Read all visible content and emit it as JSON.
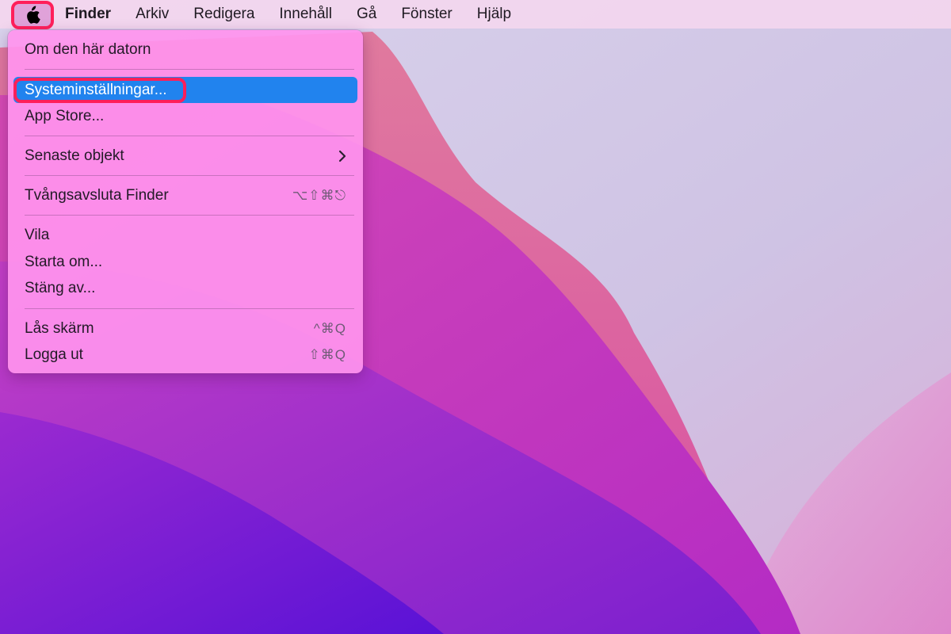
{
  "menubar": {
    "apple_icon": "apple-logo-icon",
    "items": [
      {
        "label": "Finder",
        "bold": true
      },
      {
        "label": "Arkiv"
      },
      {
        "label": "Redigera"
      },
      {
        "label": "Innehåll"
      },
      {
        "label": "Gå"
      },
      {
        "label": "Fönster"
      },
      {
        "label": "Hjälp"
      }
    ]
  },
  "apple_menu": {
    "items": [
      {
        "label": "Om den här datorn"
      },
      {
        "label": "Systeminställningar..."
      },
      {
        "label": "App Store..."
      },
      {
        "label": "Senaste objekt",
        "submenu_icon": "chevron-right-icon"
      },
      {
        "label": "Tvångsavsluta Finder",
        "shortcut": "⌥⇧⌘⎋"
      },
      {
        "label": "Vila"
      },
      {
        "label": "Starta om..."
      },
      {
        "label": "Stäng av..."
      },
      {
        "label": "Lås skärm",
        "shortcut": "^⌘Q"
      },
      {
        "label": "Logga ut",
        "shortcut": "⇧⌘Q"
      }
    ],
    "selected_index": 1
  },
  "colors": {
    "selection": "#2183ee",
    "highlight_ring": "#ff1f5a",
    "menu_background": "#ff94ee"
  }
}
